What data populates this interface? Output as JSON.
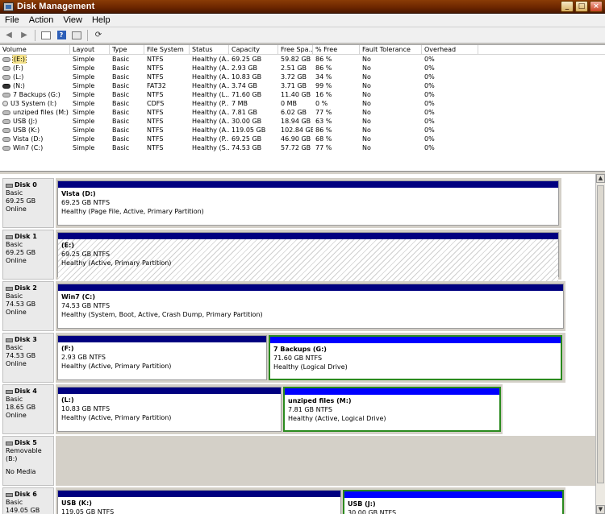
{
  "window": {
    "title": "Disk Management",
    "controls": [
      "_",
      "□",
      "×"
    ]
  },
  "menu": [
    "File",
    "Action",
    "View",
    "Help"
  ],
  "toolbar": {
    "icons": [
      "back-icon",
      "forward-icon",
      "console-icon",
      "help-icon",
      "properties-icon",
      "refresh-icon"
    ]
  },
  "volumes": {
    "headers": [
      "Volume",
      "Layout",
      "Type",
      "File System",
      "Status",
      "Capacity",
      "Free Spa...",
      "% Free",
      "Fault Tolerance",
      "Overhead"
    ],
    "rows": [
      [
        "(E:)",
        "Simple",
        "Basic",
        "NTFS",
        "Healthy (A...",
        "69.25 GB",
        "59.82 GB",
        "86 %",
        "No",
        "0%"
      ],
      [
        "(F:)",
        "Simple",
        "Basic",
        "NTFS",
        "Healthy (A...",
        "2.93 GB",
        "2.51 GB",
        "86 %",
        "No",
        "0%"
      ],
      [
        "(L:)",
        "Simple",
        "Basic",
        "NTFS",
        "Healthy (A...",
        "10.83 GB",
        "3.72 GB",
        "34 %",
        "No",
        "0%"
      ],
      [
        "(N:)",
        "Simple",
        "Basic",
        "FAT32",
        "Healthy (A...",
        "3.74 GB",
        "3.71 GB",
        "99 %",
        "No",
        "0%"
      ],
      [
        "7 Backups (G:)",
        "Simple",
        "Basic",
        "NTFS",
        "Healthy (L...",
        "71.60 GB",
        "11.40 GB",
        "16 %",
        "No",
        "0%"
      ],
      [
        "U3 System (I:)",
        "Simple",
        "Basic",
        "CDFS",
        "Healthy (P...",
        "7 MB",
        "0 MB",
        "0 %",
        "No",
        "0%"
      ],
      [
        "unziped files (M:)",
        "Simple",
        "Basic",
        "NTFS",
        "Healthy (A...",
        "7.81 GB",
        "6.02 GB",
        "77 %",
        "No",
        "0%"
      ],
      [
        "USB (J:)",
        "Simple",
        "Basic",
        "NTFS",
        "Healthy (A...",
        "30.00 GB",
        "18.94 GB",
        "63 %",
        "No",
        "0%"
      ],
      [
        "USB (K:)",
        "Simple",
        "Basic",
        "NTFS",
        "Healthy (A...",
        "119.05 GB",
        "102.84 GB",
        "86 %",
        "No",
        "0%"
      ],
      [
        "Vista (D:)",
        "Simple",
        "Basic",
        "NTFS",
        "Healthy (P...",
        "69.25 GB",
        "46.90 GB",
        "68 %",
        "No",
        "0%"
      ],
      [
        "Win7 (C:)",
        "Simple",
        "Basic",
        "NTFS",
        "Healthy (S...",
        "74.53 GB",
        "57.72 GB",
        "77 %",
        "No",
        "0%"
      ]
    ]
  },
  "disks": [
    {
      "name": "Disk 0",
      "type": "Basic",
      "size": "69.25 GB",
      "status": "Online",
      "partitions": [
        {
          "label": "Vista  (D:)",
          "size": "69.25 GB NTFS",
          "status": "Healthy (Page File, Active, Primary Partition)",
          "kind": "primary"
        }
      ]
    },
    {
      "name": "Disk 1",
      "type": "Basic",
      "size": "69.25 GB",
      "status": "Online",
      "partitions": [
        {
          "label": "(E:)",
          "size": "69.25 GB NTFS",
          "status": "Healthy (Active, Primary Partition)",
          "kind": "hatched"
        }
      ]
    },
    {
      "name": "Disk 2",
      "type": "Basic",
      "size": "74.53 GB",
      "status": "Online",
      "partitions": [
        {
          "label": "Win7  (C:)",
          "size": "74.53 GB NTFS",
          "status": "Healthy (System, Boot, Active, Crash Dump, Primary Partition)",
          "kind": "primary"
        }
      ]
    },
    {
      "name": "Disk 3",
      "type": "Basic",
      "size": "74.53 GB",
      "status": "Online",
      "partitions": [
        {
          "label": "(F:)",
          "size": "2.93 GB NTFS",
          "status": "Healthy (Active, Primary Partition)",
          "kind": "primary"
        },
        {
          "label": "7 Backups  (G:)",
          "size": "71.60 GB NTFS",
          "status": "Healthy (Logical Drive)",
          "kind": "logical"
        }
      ]
    },
    {
      "name": "Disk 4",
      "type": "Basic",
      "size": "18.65 GB",
      "status": "Online",
      "partitions": [
        {
          "label": "(L:)",
          "size": "10.83 GB NTFS",
          "status": "Healthy (Active, Primary Partition)",
          "kind": "primary"
        },
        {
          "label": "unziped files  (M:)",
          "size": "7.81 GB NTFS",
          "status": "Healthy (Active, Logical Drive)",
          "kind": "logical"
        }
      ]
    },
    {
      "name": "Disk 5",
      "type": "Removable (B:)",
      "size": "",
      "status": "No Media",
      "partitions": []
    },
    {
      "name": "Disk 6",
      "type": "Basic",
      "size": "149.05 GB",
      "status": "",
      "partitions": [
        {
          "label": "USB  (K:)",
          "size": "119.05 GB NTFS",
          "status": "",
          "kind": "primary"
        },
        {
          "label": "USB  (J:)",
          "size": "30.00 GB NTFS",
          "status": "",
          "kind": "logical"
        }
      ]
    }
  ],
  "colors": {
    "titlebar": "#6b2500",
    "primary_bar": "#000080",
    "logical_bar": "#0000ff",
    "logical_border": "#2a8a1e",
    "selection": "#f6e38a"
  }
}
